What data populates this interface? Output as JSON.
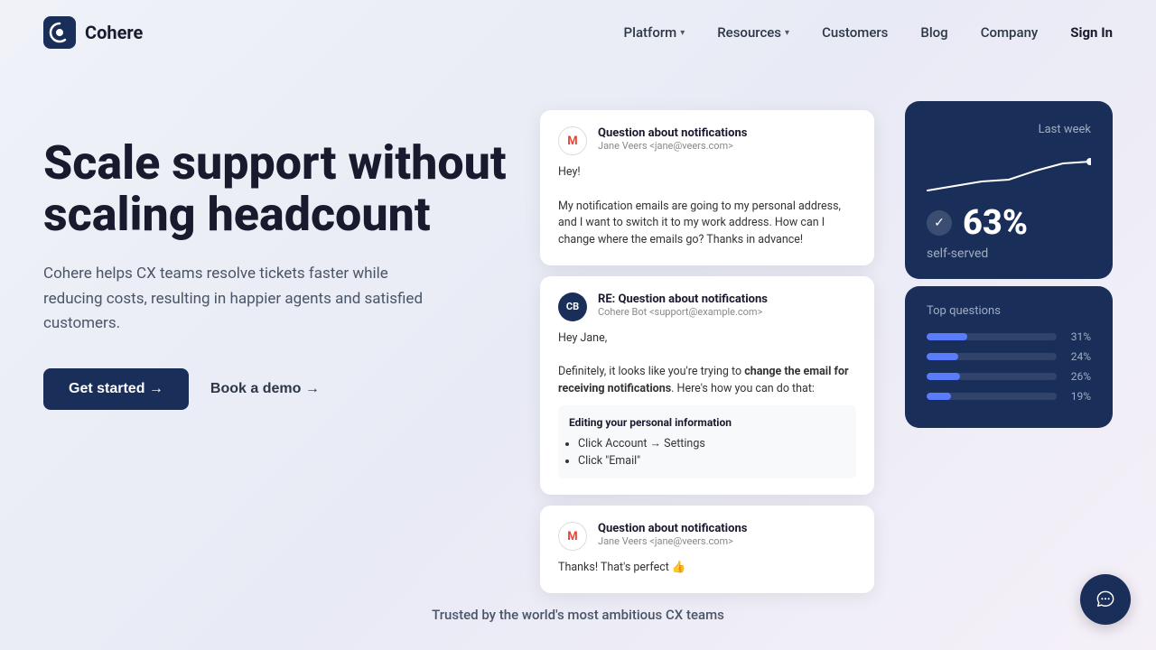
{
  "logo": {
    "name": "Cohere",
    "icon": "C"
  },
  "nav": {
    "links": [
      {
        "label": "Platform",
        "has_dropdown": true
      },
      {
        "label": "Resources",
        "has_dropdown": true
      },
      {
        "label": "Customers",
        "has_dropdown": false
      },
      {
        "label": "Blog",
        "has_dropdown": false
      },
      {
        "label": "Company",
        "has_dropdown": false
      },
      {
        "label": "Sign In",
        "has_dropdown": false,
        "style": "signin"
      }
    ]
  },
  "hero": {
    "heading_line1": "Scale support without",
    "heading_line2": "scaling headcount",
    "subtext": "Cohere helps CX teams resolve tickets faster while reducing costs, resulting in happier agents and satisfied customers.",
    "cta_primary": "Get started →",
    "cta_demo": "Book a demo →"
  },
  "email_cards": [
    {
      "id": "card1",
      "avatar_type": "gmail",
      "avatar_text": "M",
      "title": "Question about notifications",
      "from": "Jane Veers <jane@veers.com>",
      "body": "Hey!\n\nMy notification emails are going to my personal address, and I want to switch it to my work address. How can I change where the emails go? Thanks in advance!"
    },
    {
      "id": "card2",
      "avatar_type": "bot",
      "avatar_text": "CB",
      "title": "RE: Question about notifications",
      "from": "Cohere Bot <support@example.com>",
      "intro": "Hey Jane,",
      "body_before_bold": "Definitely, it looks like you're trying to ",
      "body_bold": "change the email for receiving notifications",
      "body_after": ". Here's how you can do that:",
      "editing_title": "Editing your personal information",
      "steps": [
        "Click Account → Settings",
        "Click \"Email\""
      ]
    },
    {
      "id": "card3",
      "avatar_type": "gmail",
      "avatar_text": "M",
      "title": "Question about notifications",
      "from": "Jane Veers <jane@veers.com>",
      "body": "Thanks! That's perfect 👍"
    }
  ],
  "stat_selfserved": {
    "last_week_label": "Last week",
    "percent": "63%",
    "label": "self-served"
  },
  "stat_questions": {
    "title": "Top questions",
    "bars": [
      {
        "pct": 31,
        "label": "31%"
      },
      {
        "pct": 24,
        "label": "24%"
      },
      {
        "pct": 26,
        "label": "26%"
      },
      {
        "pct": 19,
        "label": "19%"
      }
    ]
  },
  "trusted": {
    "text": "Trusted by the world's most ambitious CX teams"
  }
}
